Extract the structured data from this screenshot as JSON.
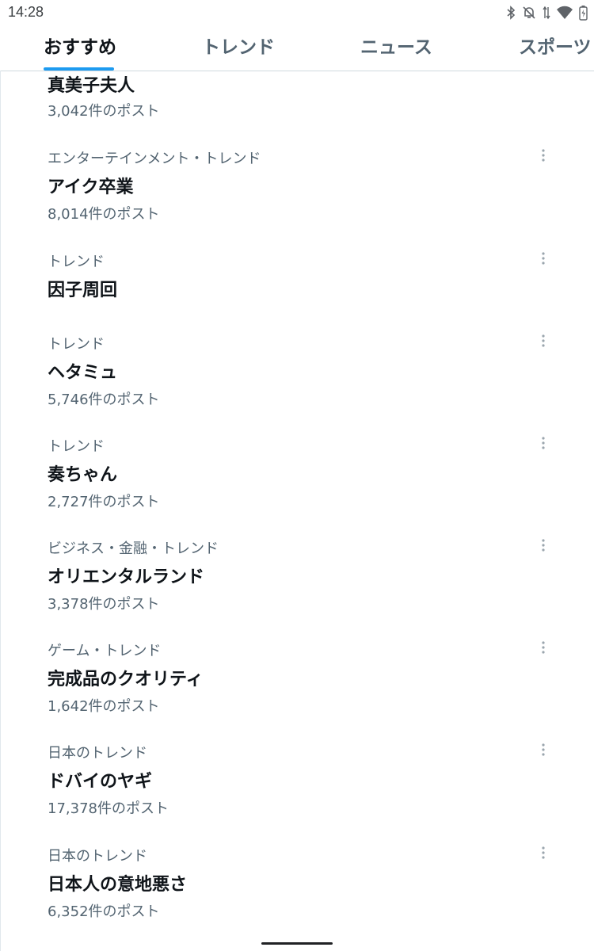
{
  "status_bar": {
    "time": "14:28",
    "icons": [
      "bluetooth-icon",
      "vibrate-off-icon",
      "data-arrows-icon",
      "wifi-icon",
      "battery-charging-icon"
    ]
  },
  "tabs": [
    {
      "label": "おすすめ",
      "active": true
    },
    {
      "label": "トレンド",
      "active": false
    },
    {
      "label": "ニュース",
      "active": false
    },
    {
      "label": "スポーツ",
      "active": false
    }
  ],
  "colors": {
    "accent": "#1d9bf0",
    "text_primary": "#0f1419",
    "text_secondary": "#536471",
    "divider": "#cfd9de"
  },
  "trends": [
    {
      "category": "",
      "title": "真美子夫人",
      "count": "3,042件のポスト",
      "has_more": false
    },
    {
      "category": "エンターテインメント・トレンド",
      "title": "アイク卒業",
      "count": "8,014件のポスト",
      "has_more": true
    },
    {
      "category": "トレンド",
      "title": "因子周回",
      "count": "",
      "has_more": true
    },
    {
      "category": "トレンド",
      "title": "ヘタミュ",
      "count": "5,746件のポスト",
      "has_more": true
    },
    {
      "category": "トレンド",
      "title": "奏ちゃん",
      "count": "2,727件のポスト",
      "has_more": true
    },
    {
      "category": "ビジネス・金融・トレンド",
      "title": "オリエンタルランド",
      "count": "3,378件のポスト",
      "has_more": true
    },
    {
      "category": "ゲーム・トレンド",
      "title": "完成品のクオリティ",
      "count": "1,642件のポスト",
      "has_more": true
    },
    {
      "category": "日本のトレンド",
      "title": "ドバイのヤギ",
      "count": "17,378件のポスト",
      "has_more": true
    },
    {
      "category": "日本のトレンド",
      "title": "日本人の意地悪さ",
      "count": "6,352件のポスト",
      "has_more": true
    }
  ]
}
